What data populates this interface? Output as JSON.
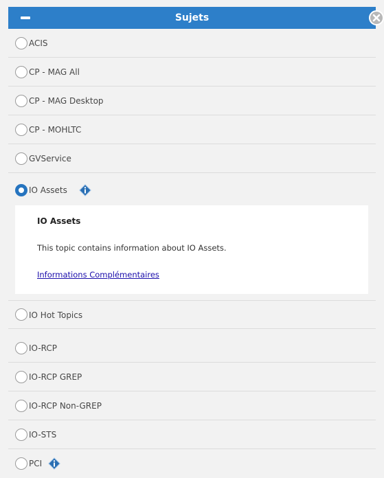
{
  "header": {
    "title": "Sujets",
    "collapse_icon": "minus-icon",
    "close_icon": "close-icon",
    "accent": "#2d7fc9"
  },
  "topics": [
    {
      "label": "ACIS",
      "selected": false
    },
    {
      "label": "CP - MAG All",
      "selected": false
    },
    {
      "label": "CP - MAG Desktop",
      "selected": false
    },
    {
      "label": "CP - MOHLTC",
      "selected": false
    },
    {
      "label": "GVService",
      "selected": false
    },
    {
      "label": "IO Assets",
      "selected": true,
      "info_icon": "info-diamond-icon"
    },
    {
      "label": "IO Hot Topics",
      "selected": false
    },
    {
      "label": "IO-RCP",
      "selected": false
    },
    {
      "label": "IO-RCP GREP",
      "selected": false
    },
    {
      "label": "IO-RCP Non-GREP",
      "selected": false
    },
    {
      "label": "IO-STS",
      "selected": false
    },
    {
      "label": "PCI",
      "selected": false,
      "info_icon": "info-diamond-icon"
    }
  ],
  "detail": {
    "title": "IO Assets",
    "description": "This topic contains information about IO Assets.",
    "link_text": "Informations Complémentaires"
  }
}
